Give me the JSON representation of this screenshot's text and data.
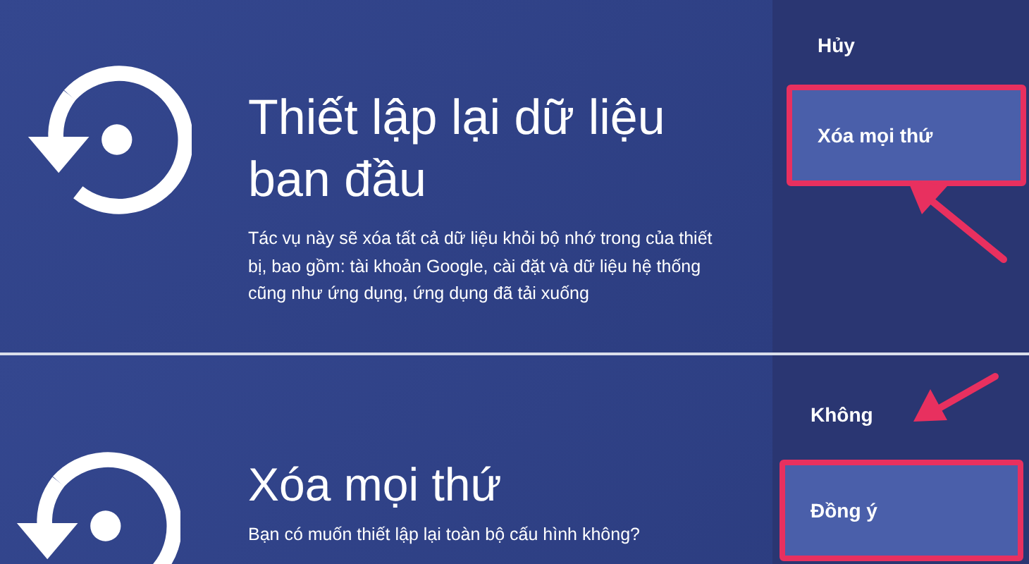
{
  "screens": [
    {
      "title": "Thiết lập lại dữ liệu ban đầu",
      "description": "Tác vụ này sẽ xóa tất cả dữ liệu khỏi bộ nhớ trong của thiết bị, bao gồm: tài khoản Google, cài đặt và dữ liệu hệ thống cũng như ứng dụng, ứng dụng đã tải xuống",
      "options": [
        {
          "label": "Hủy",
          "selected": false
        },
        {
          "label": "Xóa mọi thứ",
          "selected": true
        }
      ]
    },
    {
      "title": "Xóa mọi thứ",
      "description": "Bạn có muốn thiết lập lại toàn bộ cấu hình không?",
      "options": [
        {
          "label": "Không",
          "selected": false
        },
        {
          "label": "Đồng ý",
          "selected": true
        }
      ]
    }
  ]
}
